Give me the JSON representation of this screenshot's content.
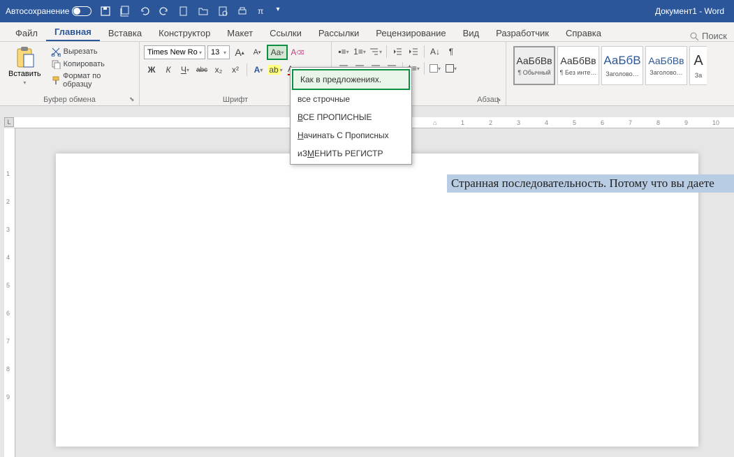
{
  "titlebar": {
    "autosave": "Автосохранение",
    "doctitle": "Документ1  -  Word"
  },
  "tabs": {
    "file": "Файл",
    "home": "Главная",
    "insert": "Вставка",
    "design": "Конструктор",
    "layout": "Макет",
    "references": "Ссылки",
    "mailings": "Рассылки",
    "review": "Рецензирование",
    "view": "Вид",
    "developer": "Разработчик",
    "help": "Справка",
    "search": "Поиск"
  },
  "ribbon": {
    "clipboard": {
      "paste": "Вставить",
      "cut": "Вырезать",
      "copy": "Копировать",
      "format_painter": "Формат по образцу",
      "label": "Буфер обмена"
    },
    "font": {
      "name": "Times New Ro",
      "size": "13",
      "label": "Шрифт",
      "bold": "Ж",
      "italic": "К",
      "underline_btn": "Ч",
      "strike": "abc",
      "sub": "x₂",
      "sup": "x²"
    },
    "paragraph": {
      "label": "Абзац"
    },
    "styles": {
      "normal_sample": "АаБбВв",
      "normal_label": "¶ Обычный",
      "nospace_sample": "АаБбВв",
      "nospace_label": "¶ Без инте…",
      "h1_sample": "АаБбВ",
      "h1_label": "Заголово…",
      "h2_sample": "АаБбВв",
      "h2_label": "Заголово…",
      "title_sample": "А",
      "title_label": "За"
    }
  },
  "dropdown": {
    "sentence": "Как в предложениях.",
    "lower": "все строчные",
    "upper": "ВСЕ ПРОПИСНЫЕ",
    "cap_each": "Начинать С Прописных",
    "toggle": "иЗМЕНИТЬ РЕГИСТР"
  },
  "document": {
    "selected_text": "Странная последовательность. Потому что вы даете"
  },
  "corner": "L"
}
